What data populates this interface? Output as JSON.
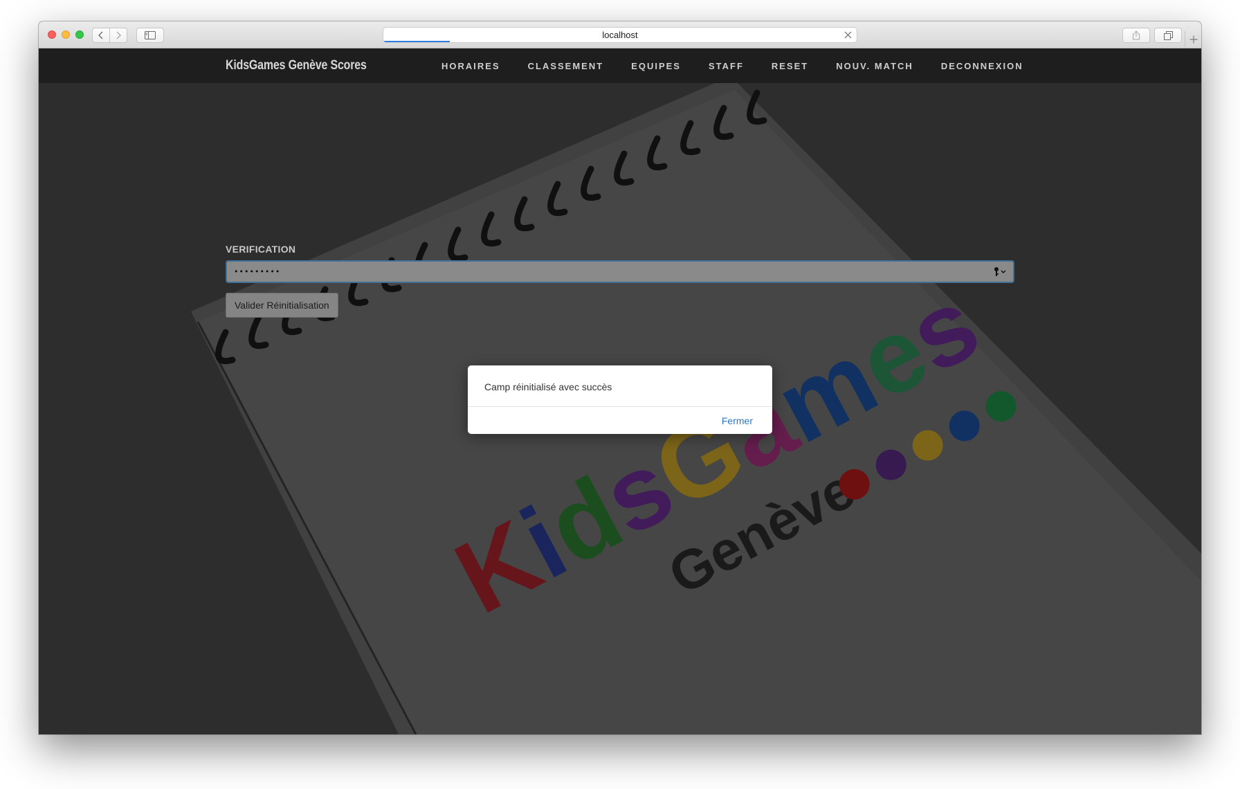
{
  "browser": {
    "url": "localhost",
    "load_progress": 0.14
  },
  "navbar": {
    "brand": "KidsGames Genève Scores",
    "links": [
      "HORAIRES",
      "CLASSEMENT",
      "EQUIPES",
      "STAFF",
      "RESET",
      "NOUV. MATCH",
      "DECONNEXION"
    ]
  },
  "form": {
    "label": "VERIFICATION",
    "password_value": "•••••••••",
    "submit_label": "Valider Réinitialisation"
  },
  "modal": {
    "message": "Camp réinitialisé avec succès",
    "close_label": "Fermer"
  },
  "logo": {
    "word1": "KidsGames",
    "word2": "Genève",
    "colors": [
      "#a5252b",
      "#2c3d96",
      "#2e7d32",
      "#6b2d91",
      "#c9a227",
      "#a42f7c",
      "#1d4fa0",
      "#2e8b57"
    ],
    "dot_colors": [
      "#b31b1b",
      "#5a2a82",
      "#c9a227",
      "#1d4fa0",
      "#1f8f4a"
    ]
  },
  "colors": {
    "navbar_bg": "#1e1e1e",
    "link": "#2a78c6",
    "input_focus": "#3f6f96"
  },
  "icons": [
    "chevron-left-icon",
    "chevron-right-icon",
    "sidebar-icon",
    "close-icon",
    "share-icon",
    "tabs-icon",
    "plus-icon",
    "key-icon"
  ]
}
